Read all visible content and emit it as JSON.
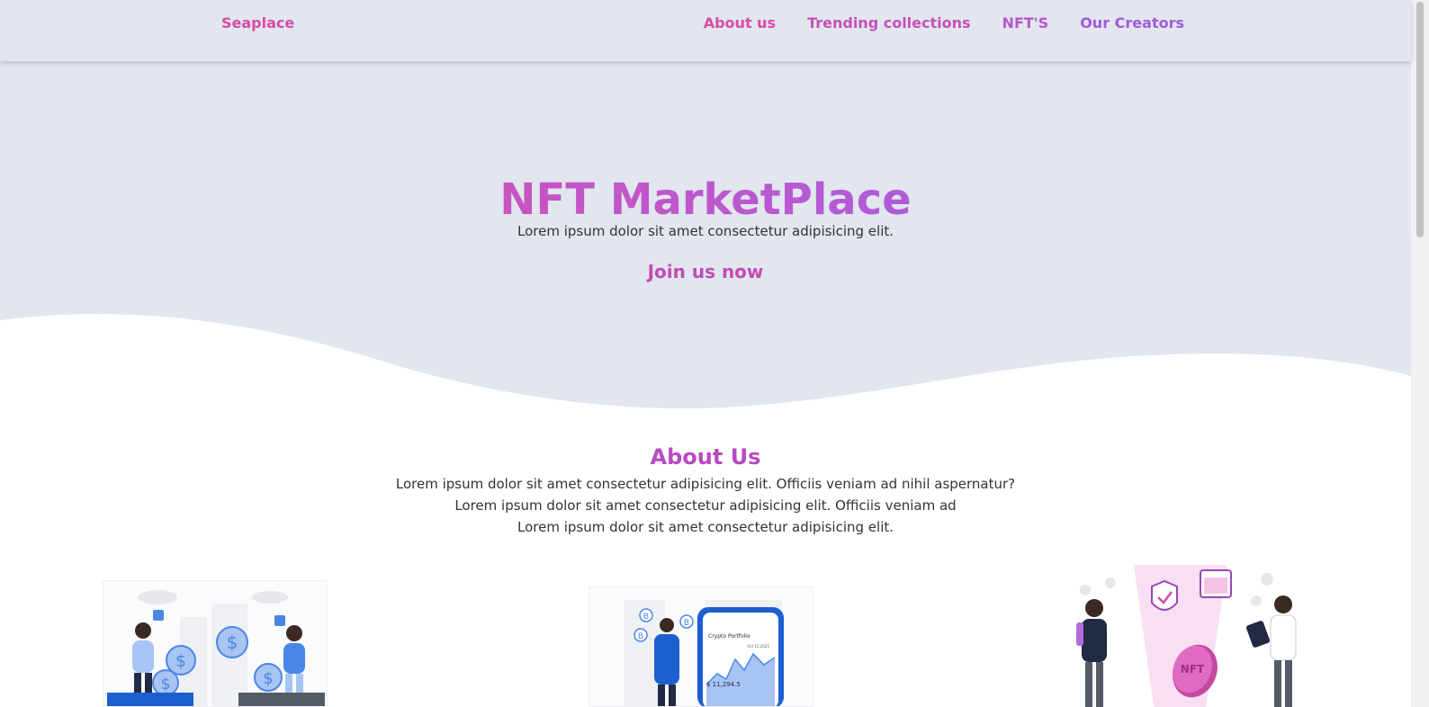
{
  "nav": {
    "brand": "Seaplace",
    "links": [
      "About us",
      "Trending collections",
      "NFT'S",
      "Our Creators"
    ]
  },
  "hero": {
    "title": "NFT MarketPlace",
    "subtitle": "Lorem ipsum dolor sit amet consectetur adipisicing elit.",
    "cta": "Join us now"
  },
  "about": {
    "title": "About Us",
    "lines": [
      "Lorem ipsum dolor sit amet consectetur adipisicing elit. Officiis veniam ad nihil aspernatur?",
      "Lorem ipsum dolor sit amet consectetur adipisicing elit. Officiis veniam ad",
      "Lorem ipsum dolor sit amet consectetur adipisicing elit."
    ]
  },
  "illustrations": {
    "phone_app_title": "Crypto Portfolio",
    "phone_date": "Oct 12,2021",
    "phone_value": "$ 11,294.5",
    "token_label": "NFT"
  },
  "colors": {
    "brand_pink": "#e84aa0",
    "brand_purple": "#8f5cf0",
    "hero_bg": "#e1e6ef",
    "illustration_blue": "#4a86e8"
  }
}
